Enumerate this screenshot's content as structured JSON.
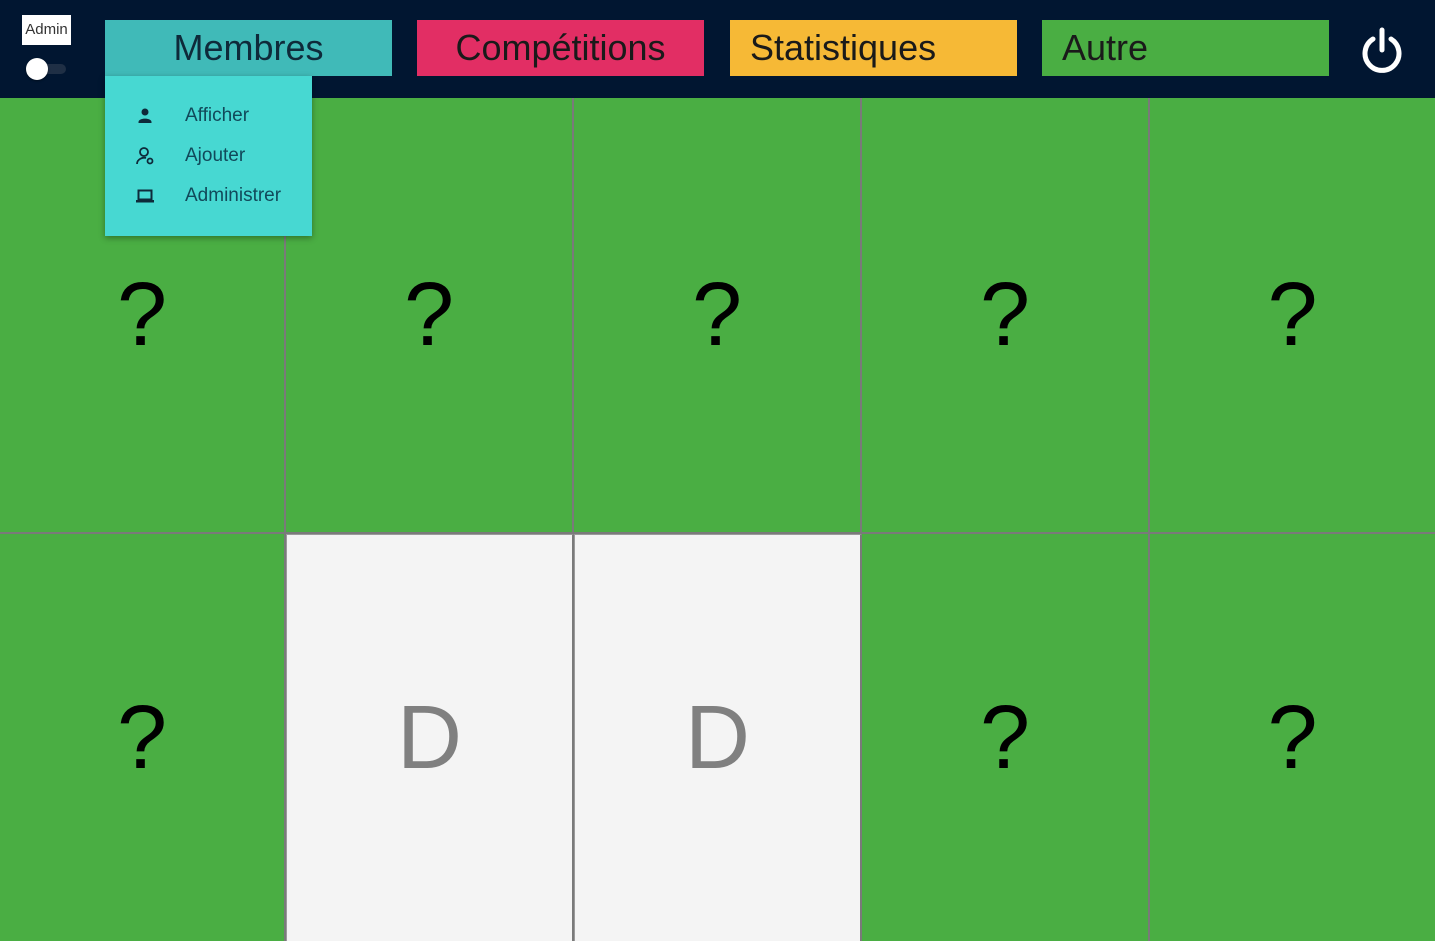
{
  "admin": {
    "label": "Admin",
    "toggle_on": false
  },
  "nav": {
    "items": [
      {
        "label": "Membres",
        "color": "#40bab8"
      },
      {
        "label": "Compétitions",
        "color": "#e22e64"
      },
      {
        "label": "Statistiques",
        "color": "#f6b936"
      },
      {
        "label": "Autre",
        "color": "#4aae43"
      }
    ],
    "power_icon": "power-icon"
  },
  "dropdown": {
    "items": [
      {
        "label": "Afficher",
        "icon": "person-icon"
      },
      {
        "label": "Ajouter",
        "icon": "person-add-icon"
      },
      {
        "label": "Administrer",
        "icon": "laptop-icon"
      }
    ]
  },
  "grid": {
    "rows": [
      [
        "?",
        "?",
        "?",
        "?",
        "?"
      ],
      [
        "?",
        "D",
        "D",
        "?",
        "?"
      ]
    ]
  },
  "colors": {
    "background": "#011631",
    "cell_hidden": "#4aae43",
    "cell_revealed": "#f4f4f4",
    "dropdown": "#47d8d2"
  }
}
